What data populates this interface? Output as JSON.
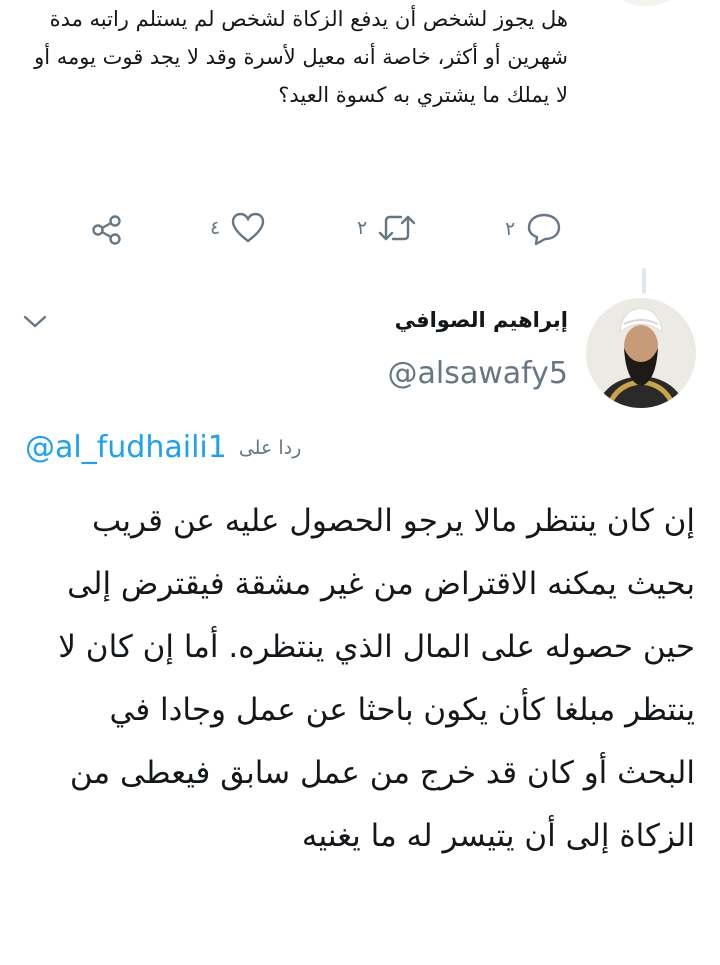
{
  "previous_tweet": {
    "text": "هل يجوز لشخص أن يدفع الزكاة لشخص لم يستلم راتبه مدة شهرين أو أكثر، خاصة أنه معيل لأسرة وقد لا يجد قوت يومه أو لا يملك ما يشتري به كسوة العيد؟",
    "actions": {
      "reply_count": "٢",
      "retweet_count": "٢",
      "like_count": "٤"
    }
  },
  "reply_tweet": {
    "author_name": "إبراهيم الصوافي",
    "author_handle": "@alsawafy5",
    "replying_to_prefix": "ردا على",
    "replying_to_handle": "@al_fudhaili1",
    "text": "إن كان ينتظر مالا يرجو الحصول عليه عن قريب بحيث يمكنه الاقتراض من غير مشقة فيقترض إلى حين حصوله على المال الذي ينتظره. أما إن كان لا ينتظر مبلغا كأن يكون باحثا عن عمل وجادا في البحث أو كان قد خرج من عمل سابق فيعطى من الزكاة إلى أن يتيسر له ما يغنيه"
  },
  "colors": {
    "accent": "#1da1f2",
    "secondary_text": "#657786",
    "primary_text": "#14171a"
  }
}
